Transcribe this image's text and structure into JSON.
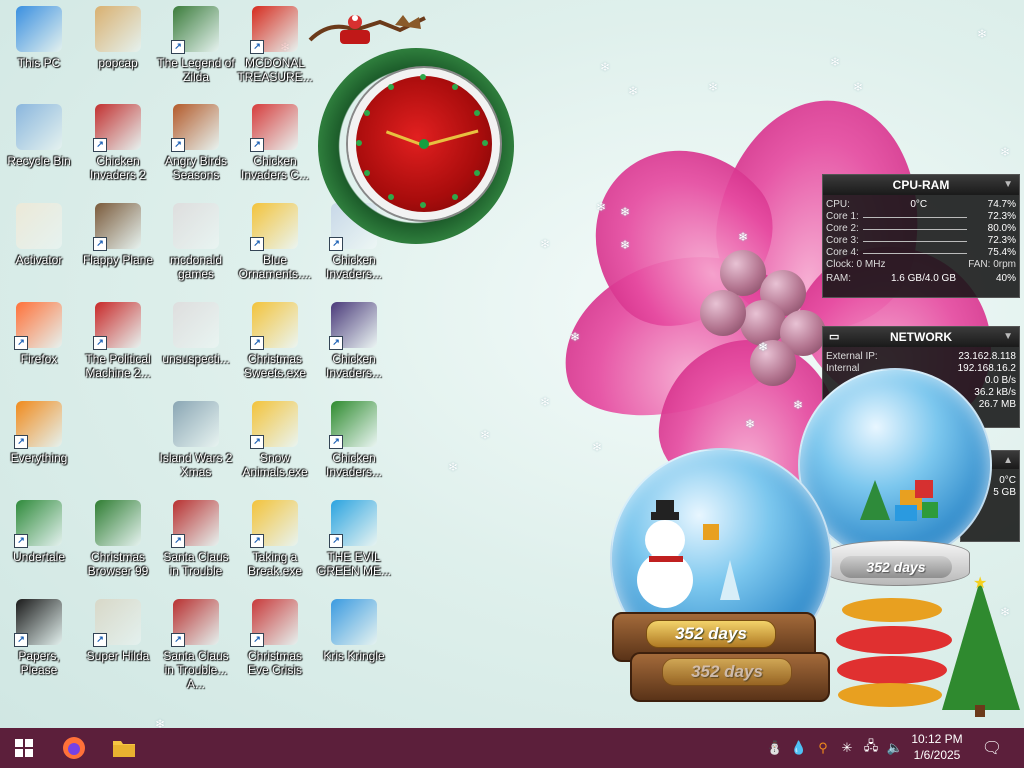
{
  "desktop": {
    "icons": [
      {
        "label": "This PC",
        "icon": "computer-icon",
        "color": "#3a8fe0",
        "shortcut": false
      },
      {
        "label": "popcap",
        "icon": "folder-icon",
        "color": "#d9b070",
        "shortcut": false
      },
      {
        "label": "The Legend of Zilda",
        "icon": "game-icon",
        "color": "#3b7c3b",
        "shortcut": true
      },
      {
        "label": "MCDONAL TREASURE...",
        "icon": "mcdonalds-icon",
        "color": "#d62b1e",
        "shortcut": true
      },
      {
        "label": "Recycle Bin",
        "icon": "recycle-bin-icon",
        "color": "#8ab6dd",
        "shortcut": false
      },
      {
        "label": "Chicken Invaders 2",
        "icon": "chicken-icon",
        "color": "#c23030",
        "shortcut": true
      },
      {
        "label": "Angry Birds Seasons",
        "icon": "angry-birds-icon",
        "color": "#b35a2a",
        "shortcut": true
      },
      {
        "label": "Chicken Invaders C...",
        "icon": "snowman-icon",
        "color": "#d63c3c",
        "shortcut": true
      },
      {
        "label": "Activator",
        "icon": "folder-icon",
        "color": "#ece9d8",
        "shortcut": false
      },
      {
        "label": "Flappy Plane",
        "icon": "plane-icon",
        "color": "#7a5a3a",
        "shortcut": true
      },
      {
        "label": "mcdonald games",
        "icon": "folder-icon",
        "color": "#dedede",
        "shortcut": false
      },
      {
        "label": "Blue Ornaments....",
        "icon": "ornament-app-icon",
        "color": "#f3c33b",
        "shortcut": true
      },
      {
        "label": "Chicken Invaders...",
        "icon": "chicken-santa-icon",
        "color": "#c8d8e8",
        "shortcut": true
      },
      {
        "label": "Firefox",
        "icon": "firefox-icon",
        "color": "#ff7139",
        "shortcut": true
      },
      {
        "label": "The Political Machine 2...",
        "icon": "political-icon",
        "color": "#c82828",
        "shortcut": true
      },
      {
        "label": "unsuspecti...",
        "icon": "folder-icon",
        "color": "#dedede",
        "shortcut": false
      },
      {
        "label": "Christmas Sweets.exe",
        "icon": "ornament-app-icon",
        "color": "#f3c33b",
        "shortcut": true
      },
      {
        "label": "Chicken Invaders...",
        "icon": "chicken-space-icon",
        "color": "#4a3a7a",
        "shortcut": true
      },
      {
        "label": "Everything",
        "icon": "search-everything-icon",
        "color": "#f08a1c",
        "shortcut": true
      },
      {
        "label": "Island Wars 2 Xmas",
        "icon": "island-icon",
        "color": "#8aa6b4",
        "shortcut": false
      },
      {
        "label": "Snow Animals.exe",
        "icon": "ornament-app-icon",
        "color": "#f3c33b",
        "shortcut": true
      },
      {
        "label": "Chicken Invaders...",
        "icon": "chicken-christmas-icon",
        "color": "#2e8b2e",
        "shortcut": true
      },
      {
        "label": "Undertale",
        "icon": "undertale-icon",
        "color": "#2e8a3a",
        "shortcut": true
      },
      {
        "label": "Christmas Browser 99",
        "icon": "christmas-tree-icon",
        "color": "#2f7d32",
        "shortcut": false
      },
      {
        "label": "Santa Claus in Trouble",
        "icon": "santa-icon",
        "color": "#b83030",
        "shortcut": true
      },
      {
        "label": "Taking a Break.exe",
        "icon": "ornament-app-icon",
        "color": "#f3c33b",
        "shortcut": true
      },
      {
        "label": "THE EVIL GREEN ME...",
        "icon": "messenger-icon",
        "color": "#2aa3e0",
        "shortcut": true
      },
      {
        "label": "Papers, Please",
        "icon": "papers-please-icon",
        "color": "#1a1a1a",
        "shortcut": true
      },
      {
        "label": "Super Hilda",
        "icon": "pixel-icon",
        "color": "#d8d8c8",
        "shortcut": true
      },
      {
        "label": "Santa Claus in Trouble... A...",
        "icon": "santa-icon",
        "color": "#b83030",
        "shortcut": true
      },
      {
        "label": "Christmas Eve Crisis",
        "icon": "santa-icon",
        "color": "#c83a3a",
        "shortcut": true
      },
      {
        "label": "Kris Kringle",
        "icon": "kris-kringle-icon",
        "color": "#3a9ae0",
        "shortcut": false
      }
    ]
  },
  "cpu_gadget": {
    "title": "CPU-RAM",
    "cpu_label": "CPU:",
    "cpu_temp": "0°C",
    "cpu_usage": "74.7%",
    "cores": [
      {
        "label": "Core 1:",
        "value": "72.3%"
      },
      {
        "label": "Core 2:",
        "value": "80.0%"
      },
      {
        "label": "Core 3:",
        "value": "72.3%"
      },
      {
        "label": "Core 4:",
        "value": "75.4%"
      }
    ],
    "clock": "Clock: 0 MHz",
    "fan": "FAN: 0rpm",
    "ram_label": "RAM:",
    "ram_value": "1.6 GB/4.0 GB",
    "ram_percent": "40%"
  },
  "network_gadget": {
    "title": "NETWORK",
    "rows": [
      {
        "label": "External IP:",
        "value": "23.162.8.118"
      },
      {
        "label": "Internal",
        "value": "192.168.16.2"
      },
      {
        "label": "",
        "value": "0.0 B/s"
      },
      {
        "label": "",
        "value": "36.2 kB/s"
      },
      {
        "label": "",
        "value": "26.7 MB"
      }
    ]
  },
  "small_gadget": {
    "temp": "0°C",
    "size": "5 GB"
  },
  "snow_globes": {
    "large_days": "352 days",
    "large_days_reflection": "352 days",
    "small_days": "352 days"
  },
  "taskbar": {
    "time": "10:12 PM",
    "date": "1/6/2025",
    "background": "#5c1f3b"
  }
}
